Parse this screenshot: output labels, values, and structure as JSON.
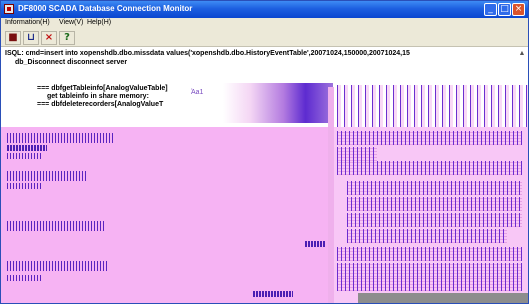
{
  "window": {
    "title": "DF8000 SCADA Database Connection Monitor",
    "controls": {
      "minimize": "_",
      "maximize": "□",
      "close": "×"
    }
  },
  "menu": {
    "items": [
      {
        "label": "Information(H)"
      },
      {
        "label": "View(V)"
      },
      {
        "label": "Help(H)"
      }
    ]
  },
  "toolbar": {
    "buttons": [
      {
        "icon": "stop-icon",
        "glyph": "■"
      },
      {
        "icon": "connect-icon",
        "glyph": "⊔"
      },
      {
        "icon": "delete-icon",
        "glyph": "×"
      },
      {
        "icon": "help-icon",
        "glyph": "?"
      }
    ]
  },
  "log": {
    "lines": [
      "ISQL: cmd=insert into xopenshdb.dbo.missdata values('xopenshdb.dbo.HistoryEventTable',20071024,150000,20071024,15",
      "db_Disconnect disconnect server"
    ],
    "memory_lines": [
      "=== dbfgetTableinfo[AnalogValueTable]",
      "get tableinfo in share memory:",
      "=== dbfdeleterecorders[AnalogValueT"
    ],
    "glyph": "Ἀa1"
  },
  "colors": {
    "titlebar": "#1d5fe0",
    "menubar": "#ece9d8",
    "glitch_overlay": "#f6b3f3",
    "glitch_pattern": "#5a24c0"
  }
}
